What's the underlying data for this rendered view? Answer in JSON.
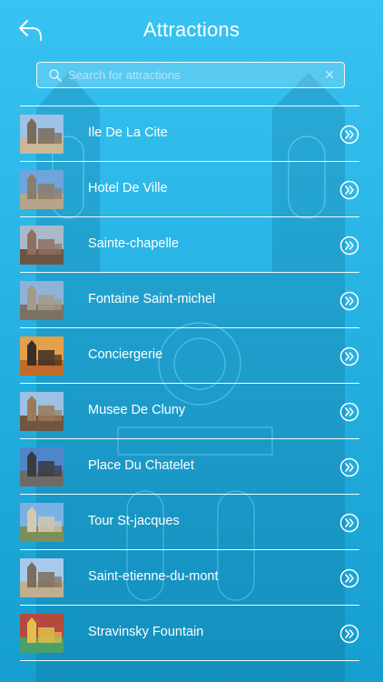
{
  "header": {
    "title": "Attractions",
    "back_icon": "back-arrow-icon"
  },
  "search": {
    "placeholder": "Search for attractions",
    "value": "",
    "search_icon": "search-icon",
    "clear_icon": "clear-icon"
  },
  "attractions": [
    {
      "label": "Ile De La Cite",
      "palette": [
        "#9ec1e6",
        "#7a6b58",
        "#c9b79a"
      ]
    },
    {
      "label": "Hotel De Ville",
      "palette": [
        "#6fa4dc",
        "#8a7d6a",
        "#b6a58a"
      ]
    },
    {
      "label": "Sainte-chapelle",
      "palette": [
        "#a9b9c9",
        "#8f6f5e",
        "#6c5447"
      ]
    },
    {
      "label": "Fontaine Saint-michel",
      "palette": [
        "#8fb3d8",
        "#a59a88",
        "#7c7263"
      ]
    },
    {
      "label": "Conciergerie",
      "palette": [
        "#e2a04a",
        "#3b2d27",
        "#c06b2a"
      ]
    },
    {
      "label": "Musee De Cluny",
      "palette": [
        "#9cc1e4",
        "#9a7a57",
        "#6e5640"
      ]
    },
    {
      "label": "Place Du Chatelet",
      "palette": [
        "#4f86c9",
        "#3a3a3f",
        "#6e6a66"
      ]
    },
    {
      "label": "Tour St-jacques",
      "palette": [
        "#7ab1e5",
        "#d4c8b0",
        "#7c8e5a"
      ]
    },
    {
      "label": "Saint-etienne-du-mont",
      "palette": [
        "#a8c9ec",
        "#7d6d5a",
        "#bfae8f"
      ]
    },
    {
      "label": "Stravinsky Fountain",
      "palette": [
        "#b34a3d",
        "#e0c04a",
        "#4aa06b"
      ]
    }
  ],
  "row_icon": "double-chevron-right-icon",
  "colors": {
    "background_top": "#38c3f2",
    "background_bottom": "#159ecf",
    "text": "#ffffff"
  }
}
